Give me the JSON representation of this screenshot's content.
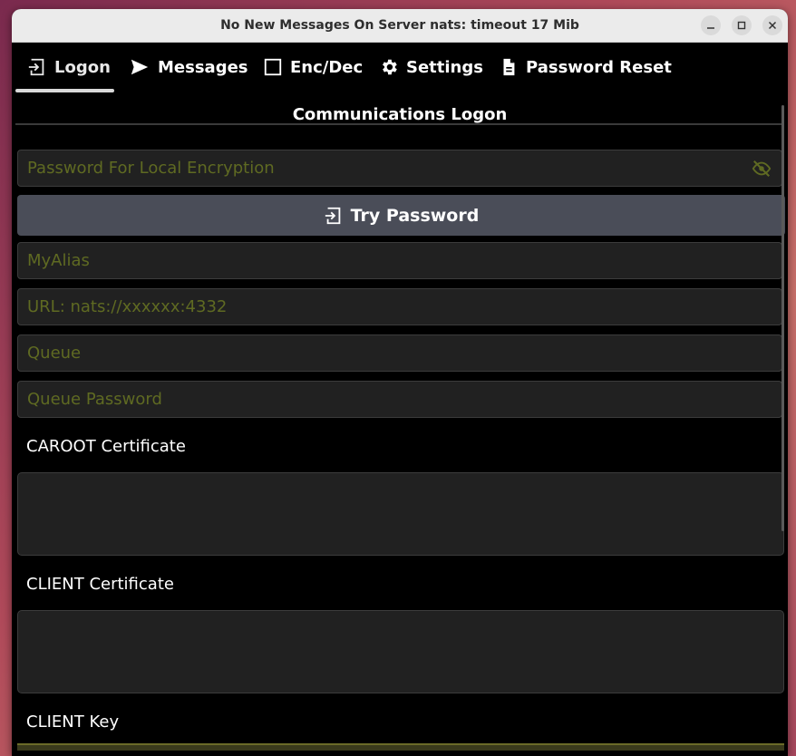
{
  "window": {
    "title": "No New Messages On Server nats: timeout 17 Mib"
  },
  "tabs": [
    {
      "label": "Logon",
      "icon": "logon-icon",
      "active": true
    },
    {
      "label": "Messages",
      "icon": "send-icon"
    },
    {
      "label": "Enc/Dec",
      "icon": "checkbox-icon"
    },
    {
      "label": "Settings",
      "icon": "gear-icon"
    },
    {
      "label": "Password Reset",
      "icon": "document-icon"
    }
  ],
  "logon": {
    "heading": "Communications Logon",
    "password_placeholder": "Password For Local Encryption",
    "try_password_label": "Try Password",
    "alias_placeholder": "MyAlias",
    "url_placeholder": "URL: nats://xxxxxx:4332",
    "queue_placeholder": "Queue",
    "queue_password_placeholder": "Queue Password",
    "caroot_label": "CAROOT Certificate",
    "client_cert_label": "CLIENT Certificate",
    "client_key_label": "CLIENT Key"
  },
  "colors": {
    "placeholder": "#5f6a22",
    "button": "#4a4d58",
    "field_bg": "#212121"
  }
}
